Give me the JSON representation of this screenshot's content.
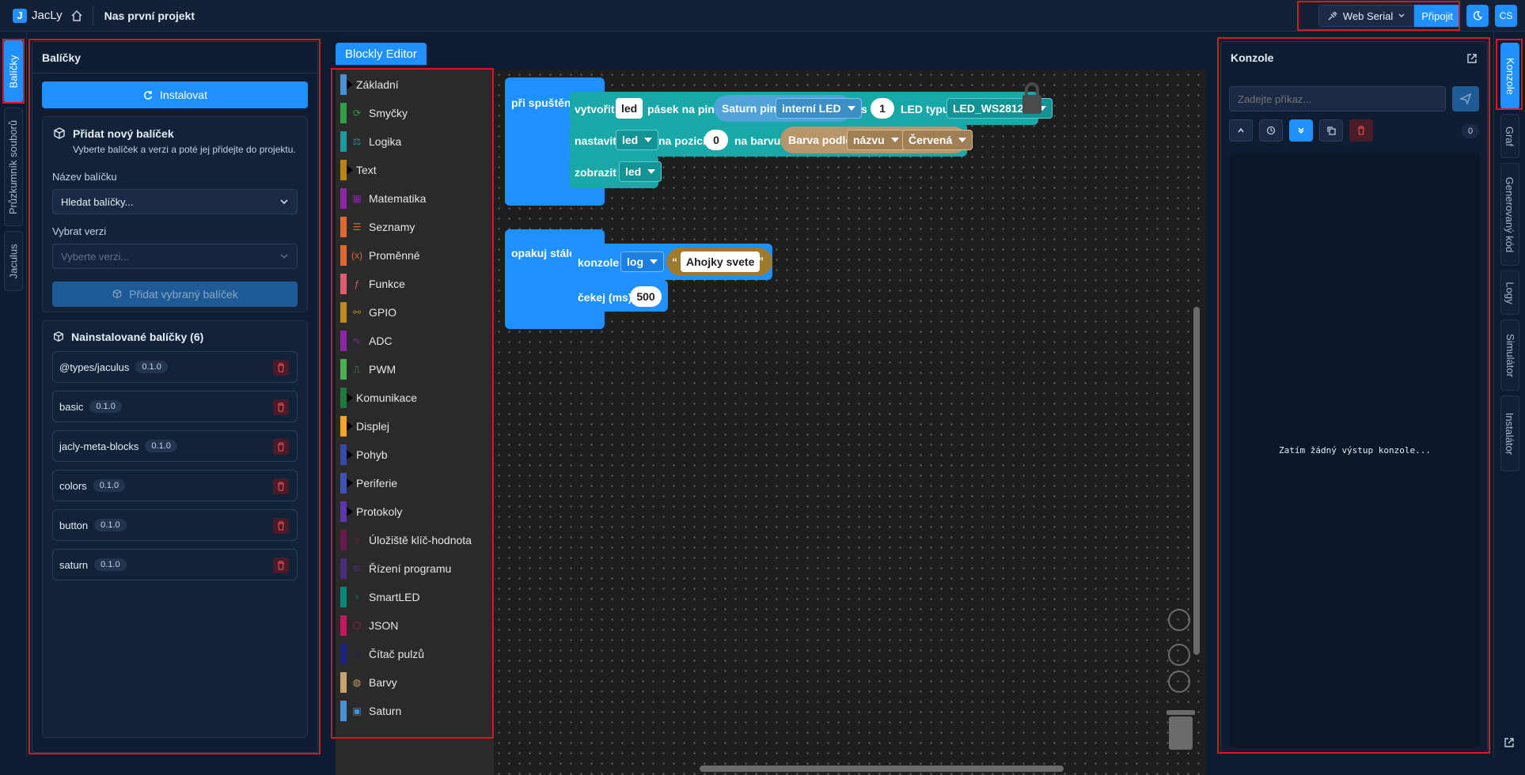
{
  "topbar": {
    "app_name": "JacLy",
    "project_name": "Nas první projekt",
    "connection_type": "Web Serial",
    "connect_label": "Připojit",
    "lang_label": "CS"
  },
  "left_tabs": [
    {
      "label": "Balíčky",
      "active": true
    },
    {
      "label": "Průzkumník souborů",
      "active": false
    },
    {
      "label": "Jaculus",
      "active": false
    }
  ],
  "packages": {
    "title": "Balíčky",
    "install_label": "Instalovat",
    "add_card": {
      "title": "Přidat nový balíček",
      "subtitle": "Vyberte balíček a verzi a poté jej přidejte do projektu.",
      "name_label": "Název balíčku",
      "search_placeholder": "Hledat balíčky...",
      "version_label": "Vybrat verzi",
      "version_placeholder": "Vyberte verzi...",
      "add_button": "Přidat vybraný balíček"
    },
    "installed_title": "Nainstalované balíčky (6)",
    "installed": [
      {
        "name": "@types/jaculus",
        "version": "0.1.0"
      },
      {
        "name": "basic",
        "version": "0.1.0"
      },
      {
        "name": "jacly-meta-blocks",
        "version": "0.1.0"
      },
      {
        "name": "colors",
        "version": "0.1.0"
      },
      {
        "name": "button",
        "version": "0.1.0"
      },
      {
        "name": "saturn",
        "version": "0.1.0"
      }
    ]
  },
  "editor": {
    "tab_label": "Blockly Editor",
    "toolbox": [
      {
        "label": "Základní",
        "color": "#4a90d9",
        "icon": "arrow-icon",
        "glyph": ""
      },
      {
        "label": "Smyčky",
        "color": "#2ea043",
        "icon": "loop-icon",
        "glyph": "⟳"
      },
      {
        "label": "Logika",
        "color": "#1a9aa0",
        "icon": "scale-icon",
        "glyph": "⚖"
      },
      {
        "label": "Text",
        "color": "#b8860b",
        "icon": "arrow-icon",
        "glyph": ""
      },
      {
        "label": "Matematika",
        "color": "#8e24aa",
        "icon": "calculator-icon",
        "glyph": "▦"
      },
      {
        "label": "Seznamy",
        "color": "#e0672d",
        "icon": "list-icon",
        "glyph": "☰"
      },
      {
        "label": "Proměnné",
        "color": "#e0672d",
        "icon": "variable-icon",
        "glyph": "(x)"
      },
      {
        "label": "Funkce",
        "color": "#e05a70",
        "icon": "function-icon",
        "glyph": "ƒ"
      },
      {
        "label": "GPIO",
        "color": "#c08a1e",
        "icon": "gpio-icon",
        "glyph": "⚯"
      },
      {
        "label": "ADC",
        "color": "#8e24aa",
        "icon": "wave-icon",
        "glyph": "∿"
      },
      {
        "label": "PWM",
        "color": "#4caf50",
        "icon": "pwm-icon",
        "glyph": "⎍"
      },
      {
        "label": "Komunikace",
        "color": "#1b7a3e",
        "icon": "arrow-icon",
        "glyph": ""
      },
      {
        "label": "Displej",
        "color": "#f5a623",
        "icon": "arrow-icon",
        "glyph": ""
      },
      {
        "label": "Pohyb",
        "color": "#3949ab",
        "icon": "arrow-icon",
        "glyph": ""
      },
      {
        "label": "Periferie",
        "color": "#3f51b5",
        "icon": "arrow-icon",
        "glyph": ""
      },
      {
        "label": "Protokoly",
        "color": "#5e35b1",
        "icon": "arrow-icon",
        "glyph": ""
      },
      {
        "label": "Úložiště klíč-hodnota",
        "color": "#6a1b4d",
        "icon": "key-icon",
        "glyph": "⚷"
      },
      {
        "label": "Řízení programu",
        "color": "#4a2d7a",
        "icon": "settings-icon",
        "glyph": "⚙"
      },
      {
        "label": "SmartLED",
        "color": "#00897b",
        "icon": "bulb-icon",
        "glyph": "♀"
      },
      {
        "label": "JSON",
        "color": "#c2185b",
        "icon": "cube-icon",
        "glyph": "⬡"
      },
      {
        "label": "Čítač pulzů",
        "color": "#1a237e",
        "icon": "pulse-icon",
        "glyph": "∿"
      },
      {
        "label": "Barvy",
        "color": "#c7a26a",
        "icon": "palette-icon",
        "glyph": "◍"
      },
      {
        "label": "Saturn",
        "color": "#4a90d9",
        "icon": "saturn-icon",
        "glyph": "▣"
      }
    ],
    "blocks": {
      "on_start": "při spuštění",
      "create": "vytvořit",
      "led_var": "led",
      "strip_on_pin": "pásek na pinu",
      "saturn_pin": "Saturn pin",
      "pin_value": "interní LED",
      "s": "s",
      "count": "1",
      "led_type": "LED typu",
      "led_model": "LED_WS2812B",
      "set": "nastavit",
      "at_position": "na pozici",
      "position": "0",
      "to_color": "na barvu",
      "color_by": "Barva podle",
      "by_name": "názvu",
      "color_name": "Červená",
      "show": "zobrazit",
      "forever": "opakuj stále",
      "console": "konzole",
      "log": "log",
      "text_value": "Ahojky svete",
      "wait": "čekej (ms)",
      "wait_value": "500"
    }
  },
  "console": {
    "title": "Konzole",
    "placeholder": "Zadejte příkaz...",
    "count": "0",
    "empty": "Zatím žádný výstup konzole..."
  },
  "right_tabs": [
    {
      "label": "Konzole"
    },
    {
      "label": "Graf"
    },
    {
      "label": "Generovaný kód"
    },
    {
      "label": "Logy"
    },
    {
      "label": "Simulátor"
    },
    {
      "label": "Instalátor"
    }
  ]
}
